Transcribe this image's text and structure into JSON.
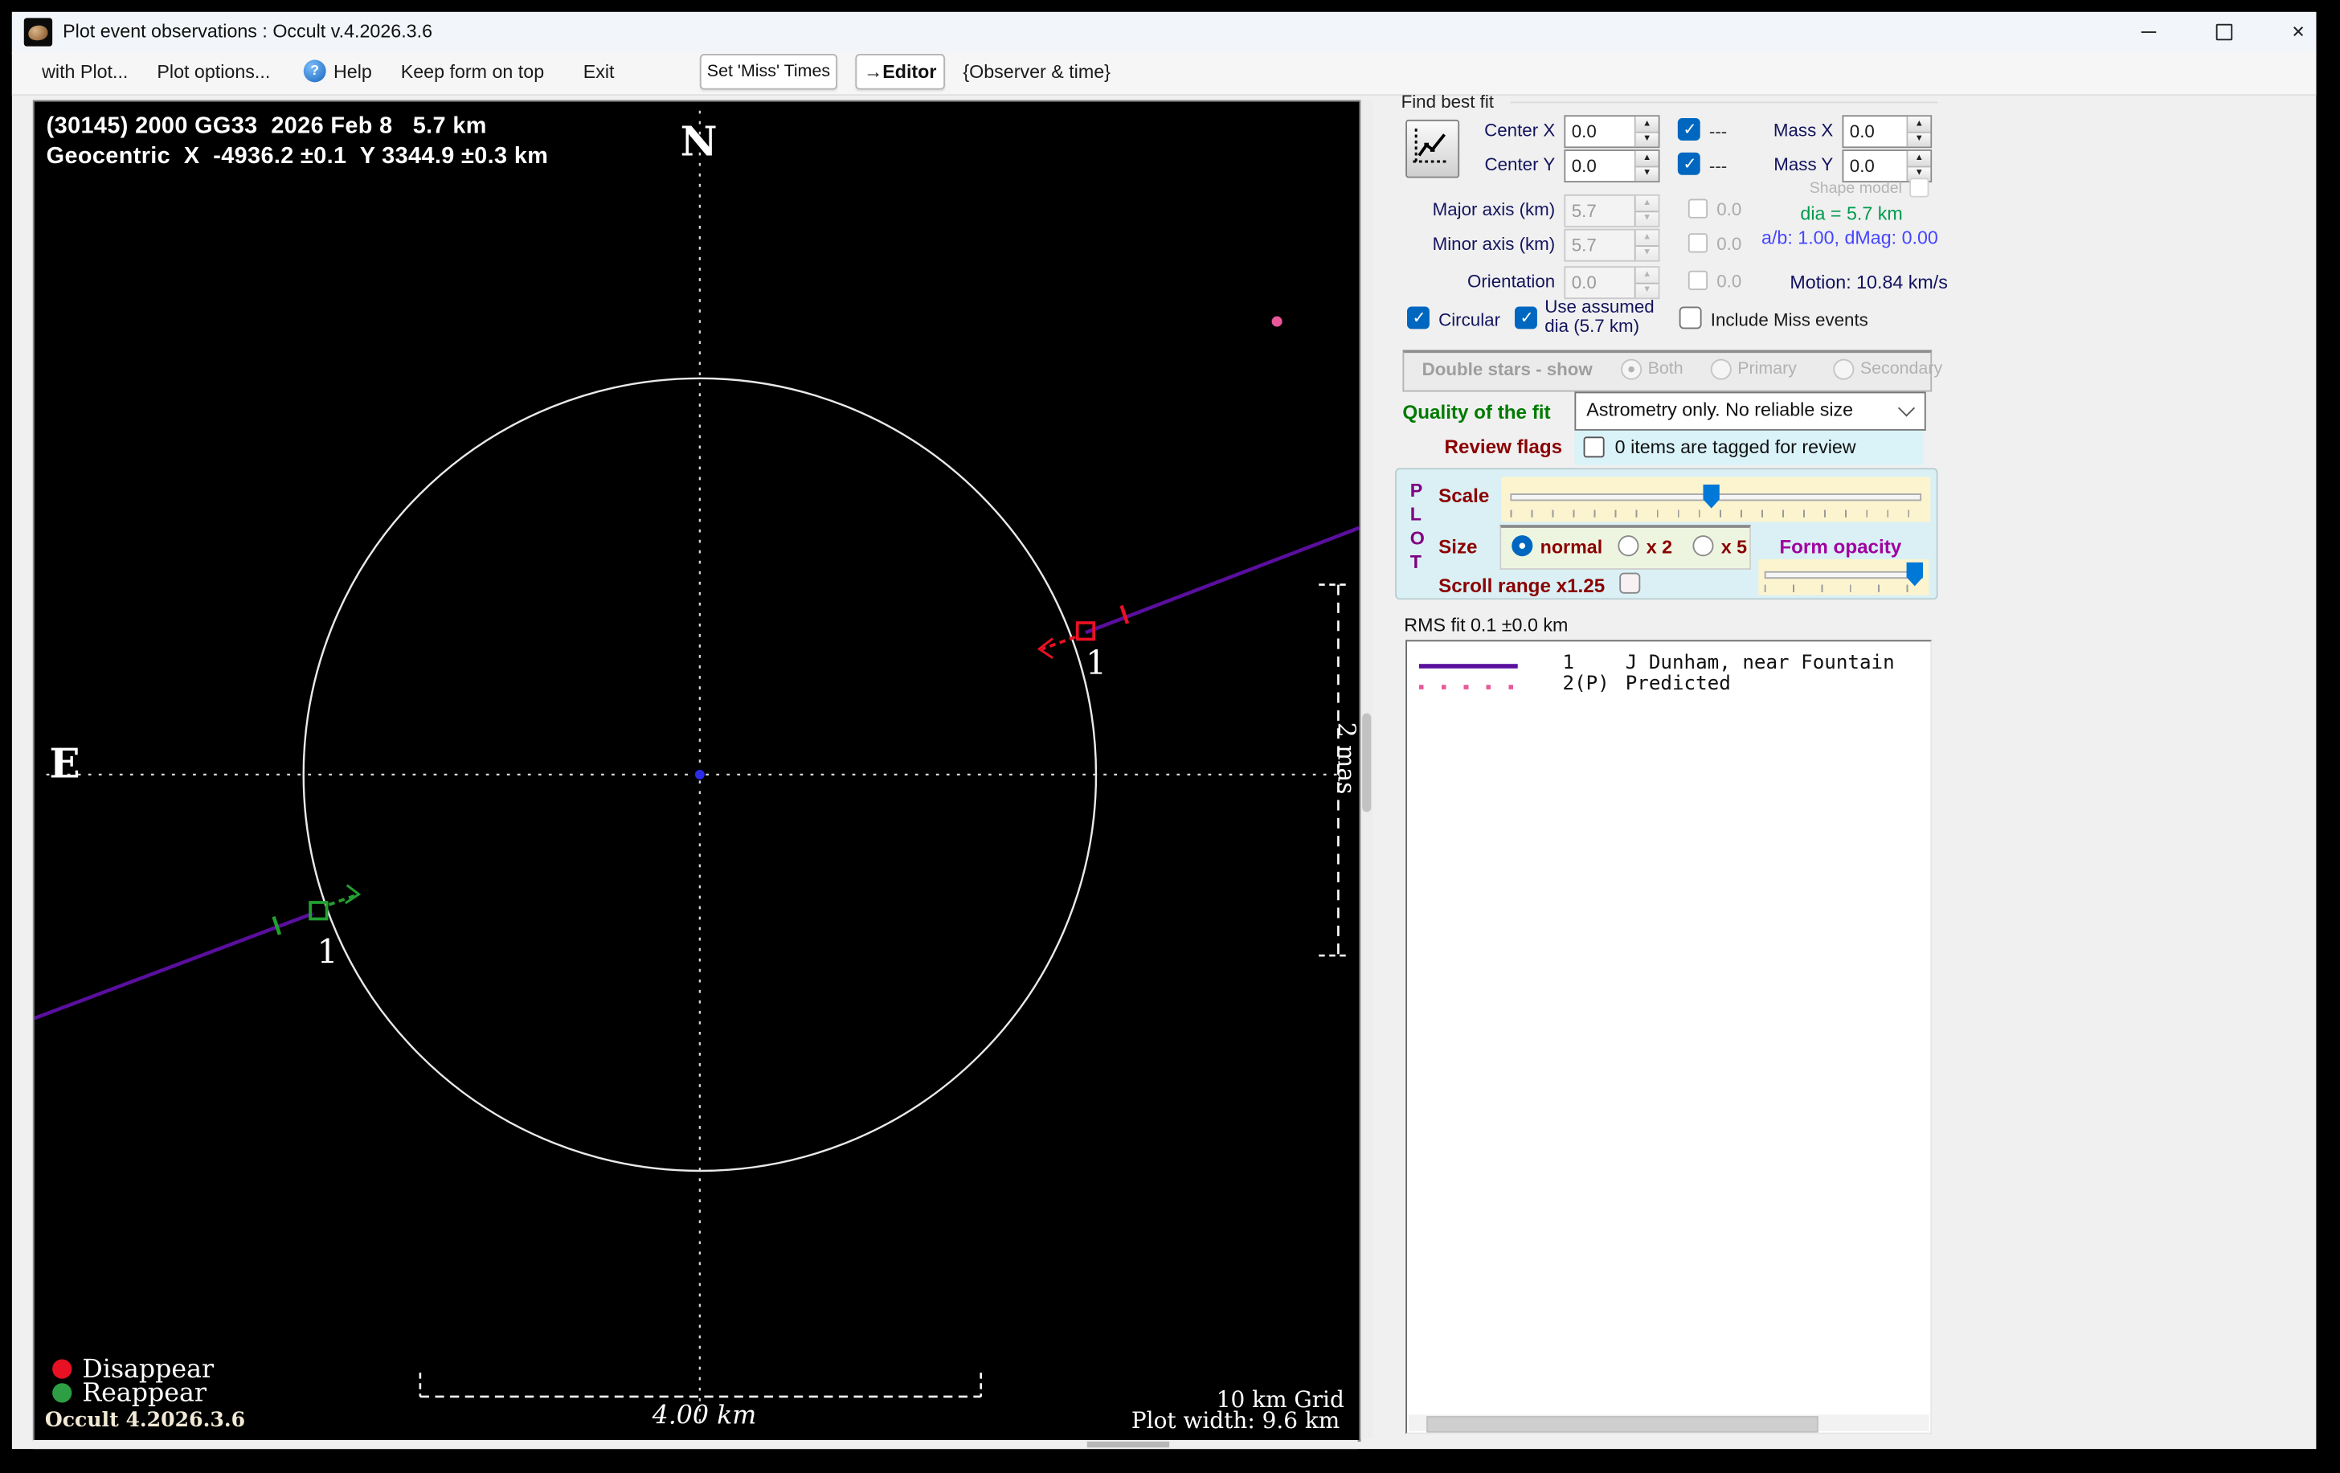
{
  "window": {
    "title": "Plot event observations : Occult v.4.2026.3.6"
  },
  "menu": {
    "with_plot": "with Plot...",
    "plot_options": "Plot options...",
    "help": "Help",
    "keep_on_top": "Keep form on top",
    "exit": "Exit",
    "set_miss_times": "Set 'Miss' Times",
    "editor": "→Editor",
    "observer_time": "{Observer & time}"
  },
  "plot": {
    "title_line1": "(30145) 2000 GG33  2026 Feb 8   5.7 km",
    "title_line2": "Geocentric  X  -4936.2 ±0.1  Y 3344.9 ±0.3 km",
    "north_label": "N",
    "east_label": "E",
    "scale_bar_label": "4.00 km",
    "mas_scale_label": "2 mas",
    "grid_label": "10 km Grid",
    "plot_width_label": "Plot width: 9.6 km",
    "version_label": "Occult 4.2026.3.6",
    "legend": {
      "disappear": "Disappear",
      "reappear": "Reappear"
    },
    "chord_d_label": "1",
    "chord_r_label": "1"
  },
  "find_best_fit": {
    "group_label": "Find best fit",
    "center_x_label": "Center X",
    "center_x_value": "0.0",
    "center_x_flag": "---",
    "center_y_label": "Center Y",
    "center_y_value": "0.0",
    "center_y_flag": "---",
    "mass_x_label": "Mass X",
    "mass_x_value": "0.0",
    "mass_y_label": "Mass Y",
    "mass_y_value": "0.0",
    "shape_model_label": "Shape model",
    "major_axis_label": "Major axis (km)",
    "major_axis_value": "5.7",
    "major_axis_err": "0.0",
    "minor_axis_label": "Minor axis (km)",
    "minor_axis_value": "5.7",
    "minor_axis_err": "0.0",
    "orientation_label": "Orientation",
    "orientation_value": "0.0",
    "orientation_err": "0.0",
    "dia_label": "dia = 5.7 km",
    "ab_dmag_label": "a/b: 1.00, dMag: 0.00",
    "motion_label": "Motion: 10.84 km/s",
    "circular_label": "Circular",
    "use_assumed_line1": "Use assumed",
    "use_assumed_line2": "dia (5.7 km)",
    "include_miss_label": "Include Miss events"
  },
  "double_stars": {
    "label": "Double stars - show",
    "both": "Both",
    "primary": "Primary",
    "secondary": "Secondary"
  },
  "quality": {
    "label": "Quality of the fit",
    "value": "Astrometry only. No reliable size"
  },
  "review": {
    "label": "Review flags",
    "text": "0 items are tagged for review"
  },
  "plot_controls": {
    "plot_vertical": [
      "P",
      "L",
      "O",
      "T"
    ],
    "scale_label": "Scale",
    "size_label": "Size",
    "size_normal": "normal",
    "size_x2": "x 2",
    "size_x5": "x 5",
    "form_opacity_label": "Form opacity",
    "scroll_range_label": "Scroll range x1.25"
  },
  "rms": {
    "text": "RMS fit 0.1 ±0.0 km"
  },
  "observations": {
    "rows": [
      {
        "id": "1",
        "name": "J Dunham, near Fountain",
        "style": "solid-purple"
      },
      {
        "id": "2(P)",
        "name": "Predicted",
        "style": "dotted-pink"
      }
    ]
  },
  "colors": {
    "chord": "#5a0f9e",
    "predicted_dots": "#e8589a",
    "disappear": "#e81123",
    "reappear": "#22a031",
    "accent": "#0067c0"
  }
}
